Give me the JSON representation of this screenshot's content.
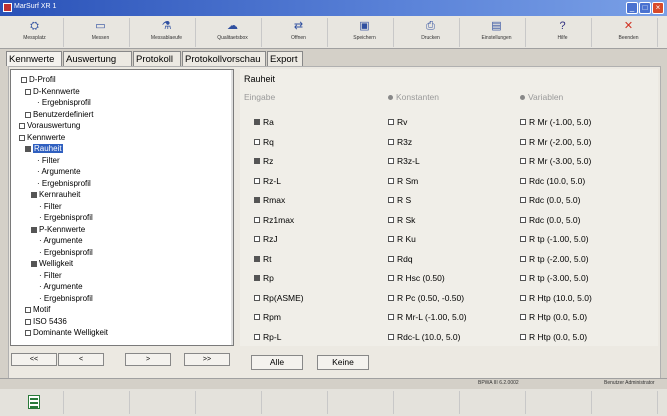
{
  "window": {
    "title": "MarSurf XR 1"
  },
  "toolbar": [
    {
      "label": "Messplatz",
      "icon": "measuring-station-icon",
      "glyph": "⛭"
    },
    {
      "label": "Messen",
      "icon": "measure-icon",
      "glyph": "▭"
    },
    {
      "label": "Messablaeufe",
      "icon": "programs-icon",
      "glyph": "⚗"
    },
    {
      "label": "Qualitaetsbox",
      "icon": "quality-icon",
      "glyph": "☁"
    },
    {
      "label": "Offnen",
      "icon": "open-icon",
      "glyph": "⇄"
    },
    {
      "label": "Speichern",
      "icon": "save-icon",
      "glyph": "▣"
    },
    {
      "label": "Drucken",
      "icon": "print-icon",
      "glyph": "⎙"
    },
    {
      "label": "Einstellungen",
      "icon": "settings-icon",
      "glyph": "▤"
    },
    {
      "label": "Hilfe",
      "icon": "help-icon",
      "glyph": "?"
    },
    {
      "label": "Beenden",
      "icon": "exit-icon",
      "glyph": "✕"
    }
  ],
  "tabs": [
    "Kennwerte",
    "Auswertung",
    "Protokoll",
    "Protokollvorschau",
    "Export"
  ],
  "tree": [
    {
      "label": "D-Profil",
      "sq": "open"
    },
    {
      "label": "D-Kennwerte",
      "sq": "open"
    },
    {
      "label": "Ergebnisprofil",
      "sq": "none"
    },
    {
      "label": "Benutzerdefiniert",
      "sq": "open"
    },
    {
      "label": "Vorauswertung",
      "sq": "open"
    },
    {
      "label": "Kennwerte",
      "sq": "open"
    },
    {
      "label": "Rauheit",
      "sq": "filled"
    },
    {
      "label": "Filter",
      "sq": "none"
    },
    {
      "label": "Argumente",
      "sq": "none"
    },
    {
      "label": "Ergebnisprofil",
      "sq": "none"
    },
    {
      "label": "Kernrauheit",
      "sq": "filled"
    },
    {
      "label": "Filter",
      "sq": "none"
    },
    {
      "label": "Ergebnisprofil",
      "sq": "none"
    },
    {
      "label": "P-Kennwerte",
      "sq": "filled"
    },
    {
      "label": "Argumente",
      "sq": "none"
    },
    {
      "label": "Ergebnisprofil",
      "sq": "none"
    },
    {
      "label": "Welligkeit",
      "sq": "filled"
    },
    {
      "label": "Filter",
      "sq": "none"
    },
    {
      "label": "Argumente",
      "sq": "none"
    },
    {
      "label": "Ergebnisprofil",
      "sq": "none"
    },
    {
      "label": "Motif",
      "sq": "open"
    },
    {
      "label": "ISO 5436",
      "sq": "open"
    },
    {
      "label": "Dominante Welligkeit",
      "sq": "open"
    }
  ],
  "nav": [
    "<<",
    "<",
    ">",
    ">>"
  ],
  "right": {
    "title": "Rauheit",
    "headers": [
      "Eingabe",
      "Konstanten",
      "Variablen"
    ],
    "col1": [
      {
        "label": "Ra",
        "on": true
      },
      {
        "label": "Rq",
        "on": false
      },
      {
        "label": "Rz",
        "on": true
      },
      {
        "label": "Rz-L",
        "on": false
      },
      {
        "label": "Rmax",
        "on": true
      },
      {
        "label": "Rz1max",
        "on": false
      },
      {
        "label": "RzJ",
        "on": false
      },
      {
        "label": "Rt",
        "on": true
      },
      {
        "label": "Rp",
        "on": true
      },
      {
        "label": "Rp(ASME)",
        "on": false
      },
      {
        "label": "Rpm",
        "on": false
      },
      {
        "label": "Rp-L",
        "on": false
      }
    ],
    "col2": [
      {
        "label": "Rv",
        "on": false
      },
      {
        "label": "R3z",
        "on": false
      },
      {
        "label": "R3z-L",
        "on": false
      },
      {
        "label": "R Sm",
        "on": false
      },
      {
        "label": "R S",
        "on": false
      },
      {
        "label": "R Sk",
        "on": false
      },
      {
        "label": "R Ku",
        "on": false
      },
      {
        "label": "Rdq",
        "on": false
      },
      {
        "label": "R Hsc (0.50)",
        "on": false
      },
      {
        "label": "R Pc (0.50, -0.50)",
        "on": false
      },
      {
        "label": "R Mr-L (-1.00, 5.0)",
        "on": false
      },
      {
        "label": "Rdc-L (10.0, 5.0)",
        "on": false
      }
    ],
    "col3": [
      {
        "label": "R Mr (-1.00, 5.0)",
        "on": false
      },
      {
        "label": "R Mr (-2.00, 5.0)",
        "on": false
      },
      {
        "label": "R Mr (-3.00, 5.0)",
        "on": false
      },
      {
        "label": "Rdc (10.0, 5.0)",
        "on": false
      },
      {
        "label": "Rdc (0.0, 5.0)",
        "on": false
      },
      {
        "label": "Rdc (0.0, 5.0)",
        "on": false
      },
      {
        "label": "R tp (-1.00, 5.0)",
        "on": false
      },
      {
        "label": "R tp (-2.00, 5.0)",
        "on": false
      },
      {
        "label": "R tp (-3.00, 5.0)",
        "on": false
      },
      {
        "label": "R Htp (10.0, 5.0)",
        "on": false
      },
      {
        "label": "R Htp (0.0, 5.0)",
        "on": false
      },
      {
        "label": "R Htp (0.0, 5.0)",
        "on": false
      }
    ],
    "buttons": {
      "all": "Alle",
      "none": "Keine"
    }
  },
  "status": {
    "version": "BPWA III 6.2.0002",
    "user": "Benutzer Administrator"
  },
  "bottom": {
    "home_icon": "home-icon"
  }
}
